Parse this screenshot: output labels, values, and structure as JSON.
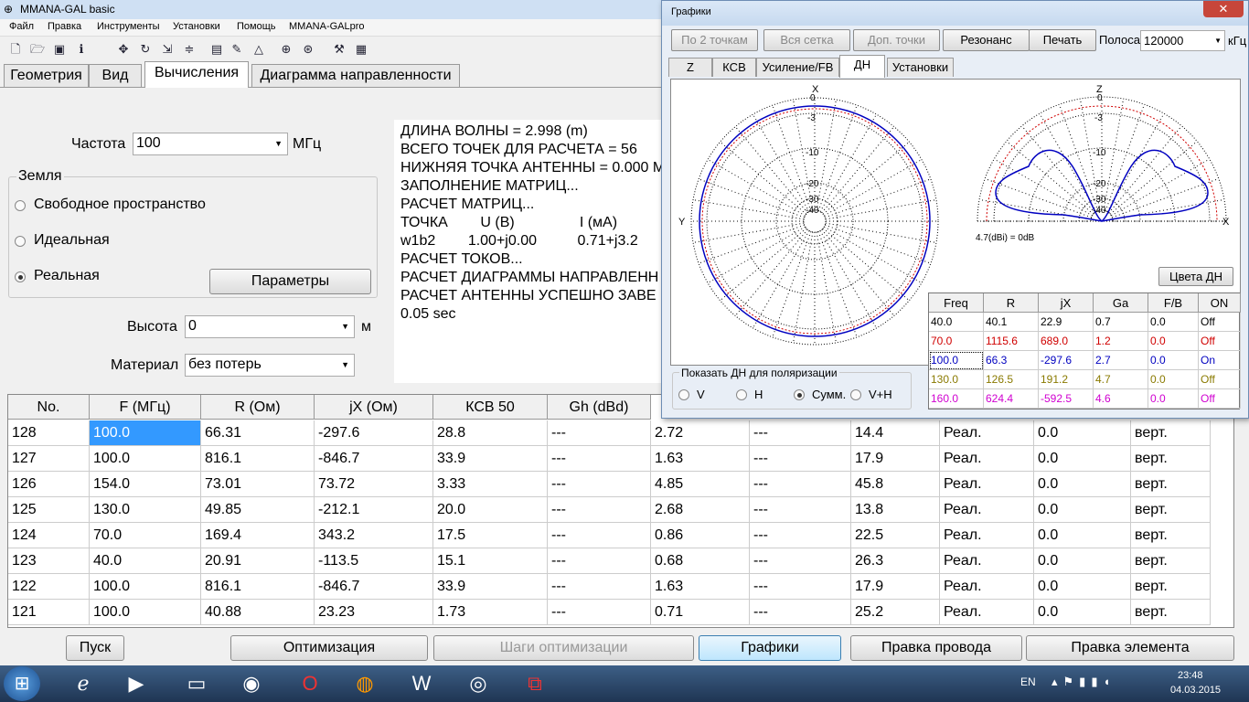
{
  "app": {
    "title": "MMANA-GAL basic"
  },
  "menu": [
    "Файл",
    "Правка",
    "Инструменты",
    "Установки",
    "Помощь",
    "MMANA-GALpro"
  ],
  "tabs": [
    "Геометрия",
    "Вид",
    "Вычисления",
    "Диаграмма направленности"
  ],
  "calc": {
    "freq_label": "Частота",
    "freq_value": "100",
    "freq_unit": "МГц",
    "ground_label": "Земля",
    "ground_options": [
      "Свободное пространство",
      "Идеальная",
      "Реальная"
    ],
    "params_button": "Параметры",
    "height_label": "Высота",
    "height_value": "0",
    "height_unit": "м",
    "material_label": "Материал",
    "material_value": "без потерь"
  },
  "output_lines": [
    "ДЛИНА ВОЛНЫ = 2.998 (m)",
    "ВСЕГО ТОЧЕК ДЛЯ РАСЧЕТА = 56",
    "НИЖНЯЯ ТОЧКА АНТЕННЫ = 0.000 M",
    "ЗАПОЛНЕНИЕ МАТРИЦ...",
    "РАСЧЕТ МАТРИЦ...",
    "ТОЧКА        U (B)                I (мA)",
    "w1b2        1.00+j0.00          0.71+j3.2",
    "РАСЧЕТ ТОКОВ...",
    "РАСЧЕТ ДИАГРАММЫ НАПРАВЛЕНН",
    "РАСЧЕТ АНТЕННЫ УСПЕШНО ЗАВЕ",
    "0.05 sec"
  ],
  "table": {
    "headers": [
      "No.",
      "F (МГц)",
      "R (Ом)",
      "jX (Ом)",
      "КСВ 50",
      "Gh (dBd)"
    ],
    "rows": [
      [
        "128",
        "100.0",
        "66.31",
        "-297.6",
        "28.8",
        "---",
        "2.72",
        "---",
        "14.4",
        "Реал.",
        "0.0",
        "верт."
      ],
      [
        "127",
        "100.0",
        "816.1",
        "-846.7",
        "33.9",
        "---",
        "1.63",
        "---",
        "17.9",
        "Реал.",
        "0.0",
        "верт."
      ],
      [
        "126",
        "154.0",
        "73.01",
        "73.72",
        "3.33",
        "---",
        "4.85",
        "---",
        "45.8",
        "Реал.",
        "0.0",
        "верт."
      ],
      [
        "125",
        "130.0",
        "49.85",
        "-212.1",
        "20.0",
        "---",
        "2.68",
        "---",
        "13.8",
        "Реал.",
        "0.0",
        "верт."
      ],
      [
        "124",
        "70.0",
        "169.4",
        "343.2",
        "17.5",
        "---",
        "0.86",
        "---",
        "22.5",
        "Реал.",
        "0.0",
        "верт."
      ],
      [
        "123",
        "40.0",
        "20.91",
        "-113.5",
        "15.1",
        "---",
        "0.68",
        "---",
        "26.3",
        "Реал.",
        "0.0",
        "верт."
      ],
      [
        "122",
        "100.0",
        "816.1",
        "-846.7",
        "33.9",
        "---",
        "1.63",
        "---",
        "17.9",
        "Реал.",
        "0.0",
        "верт."
      ],
      [
        "121",
        "100.0",
        "40.88",
        "23.23",
        "1.73",
        "---",
        "0.71",
        "---",
        "25.2",
        "Реал.",
        "0.0",
        "верт."
      ]
    ]
  },
  "bottom_buttons": [
    "Пуск",
    "Оптимизация",
    "Шаги оптимизации",
    "Графики",
    "Правка провода",
    "Правка элемента"
  ],
  "graphs": {
    "title": "Графики",
    "buttons": [
      "По 2 точкам",
      "Вся сетка",
      "Доп. точки",
      "Резонанс",
      "Печать"
    ],
    "band_label": "Полоса",
    "band_value": "120000",
    "band_unit": "кГц",
    "tabs": [
      "Z",
      "КСВ",
      "Усиление/FB",
      "ДН",
      "Установки"
    ],
    "horiz_labels": {
      "top": "X",
      "left": "Y"
    },
    "vert_labels": {
      "top": "Z",
      "right": "X"
    },
    "ring_labels": [
      "0",
      "-3",
      "-10",
      "-20",
      "-30",
      "-40"
    ],
    "gain_note": "4.7(dBi) = 0dB",
    "colors_button": "Цвета ДН",
    "polar_group": "Показать ДН для поляризации",
    "polar_options": [
      "V",
      "H",
      "Сумм.",
      "V+H"
    ],
    "freq_table": {
      "headers": [
        "Freq",
        "R",
        "jX",
        "Ga",
        "F/B",
        "ON"
      ],
      "rows": [
        {
          "cells": [
            "40.0",
            "40.1",
            "22.9",
            "0.7",
            "0.0",
            "Off"
          ],
          "color": "#000000"
        },
        {
          "cells": [
            "70.0",
            "1115.6",
            "689.0",
            "1.2",
            "0.0",
            "Off"
          ],
          "color": "#d00000"
        },
        {
          "cells": [
            "100.0",
            "66.3",
            "-297.6",
            "2.7",
            "0.0",
            "On"
          ],
          "color": "#0000c0"
        },
        {
          "cells": [
            "130.0",
            "126.5",
            "191.2",
            "4.7",
            "0.0",
            "Off"
          ],
          "color": "#8a7a00"
        },
        {
          "cells": [
            "160.0",
            "624.4",
            "-592.5",
            "4.6",
            "0.0",
            "Off"
          ],
          "color": "#d000d0"
        }
      ]
    }
  },
  "taskbar": {
    "lang": "EN",
    "time": "23:48",
    "date": "04.03.2015"
  }
}
